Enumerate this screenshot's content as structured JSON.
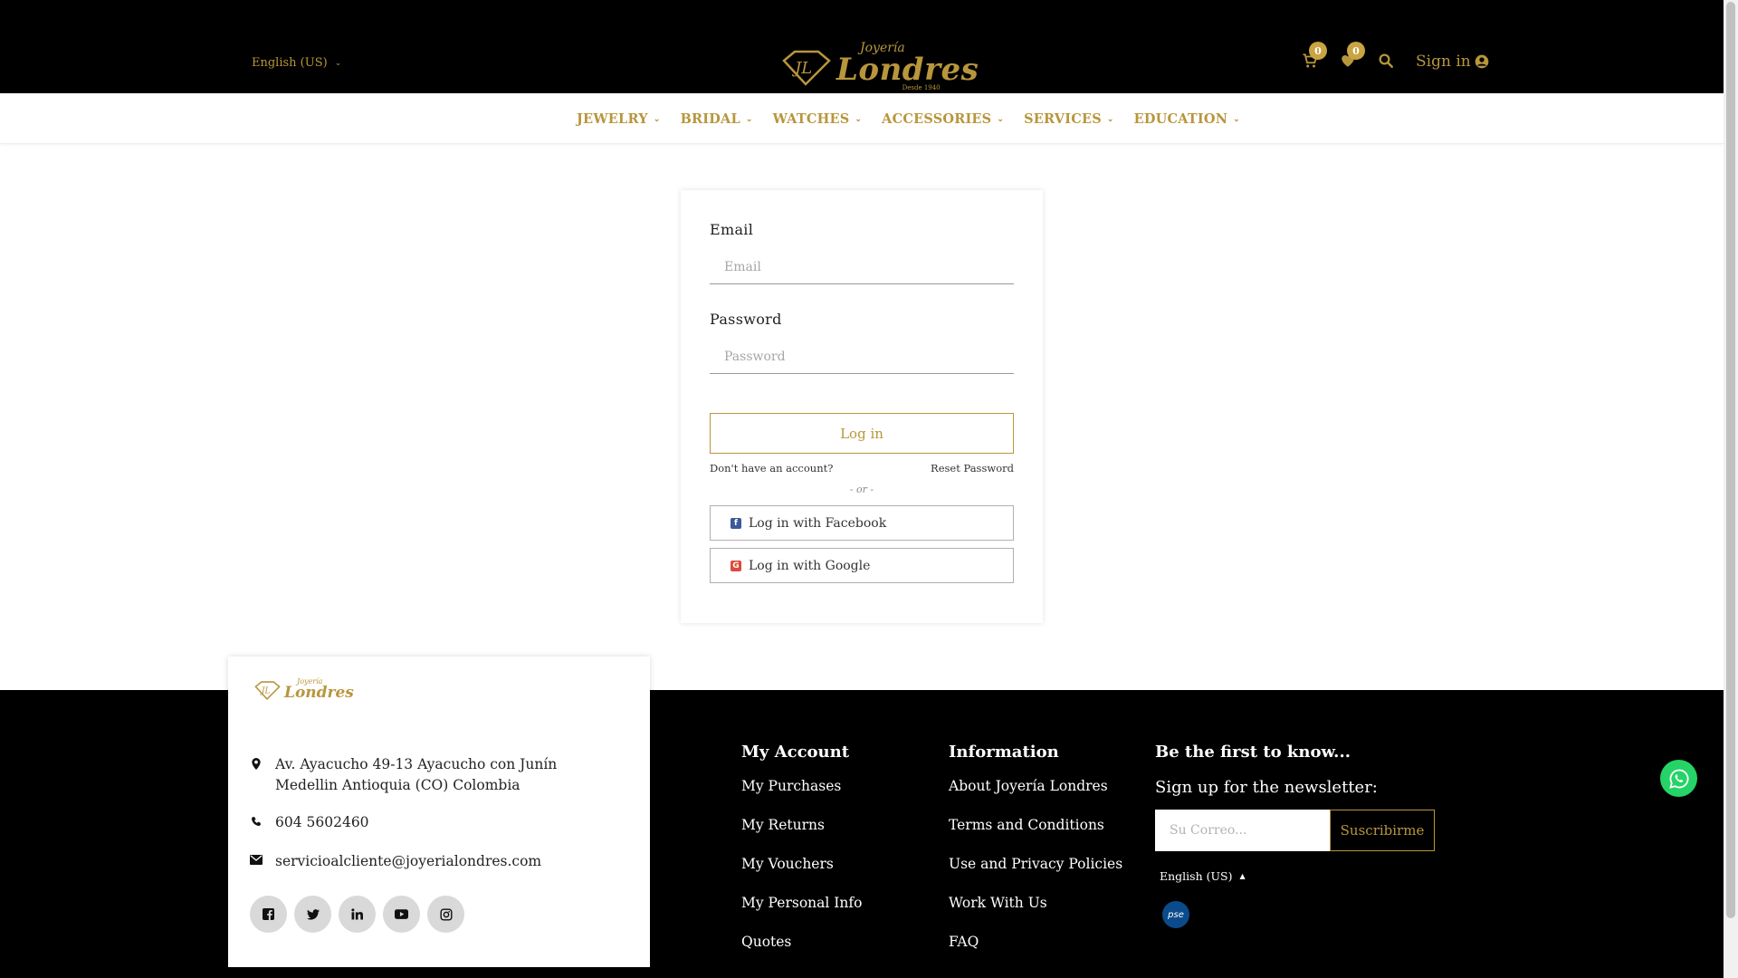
{
  "header": {
    "language": "English (US)",
    "logo": {
      "small": "Joyería",
      "big": "Londres",
      "tagline": "Desde 1940"
    },
    "cart_count": "0",
    "wishlist_count": "0",
    "signin_label": "Sign in"
  },
  "nav": {
    "items": [
      {
        "label": "JEWELRY"
      },
      {
        "label": "BRIDAL"
      },
      {
        "label": "WATCHES"
      },
      {
        "label": "ACCESSORIES"
      },
      {
        "label": "SERVICES"
      },
      {
        "label": "EDUCATION"
      }
    ]
  },
  "login": {
    "email_label": "Email",
    "email_placeholder": "Email",
    "password_label": "Password",
    "password_placeholder": "Password",
    "login_button": "Log in",
    "no_account": "Don't have an account?",
    "reset_password": "Reset Password",
    "or": "- or -",
    "facebook": "Log in with Facebook",
    "google": "Log in with Google"
  },
  "footer": {
    "address": "Av. Ayacucho 49-13 Ayacucho con Junín Medellin Antioquia (CO) Colombia",
    "phone": "604 5602460",
    "email": "servicioalcliente@joyerialondres.com",
    "my_account": {
      "title": "My Account",
      "links": [
        "My Purchases",
        "My Returns",
        "My Vouchers",
        "My Personal Info",
        "Quotes"
      ]
    },
    "information": {
      "title": "Information",
      "links": [
        "About Joyería Londres",
        "Terms and Conditions",
        "Use and Privacy Policies",
        "Work With Us",
        "FAQ"
      ]
    },
    "newsletter": {
      "title": "Be the first to know...",
      "subtitle": "Sign up for the newsletter:",
      "placeholder": "Su Correo...",
      "button": "Suscribirme"
    },
    "language": "English (US)",
    "pse_label": "pse"
  },
  "colors": {
    "gold": "#b8963c",
    "black": "#000000",
    "whatsapp": "#25d366"
  }
}
